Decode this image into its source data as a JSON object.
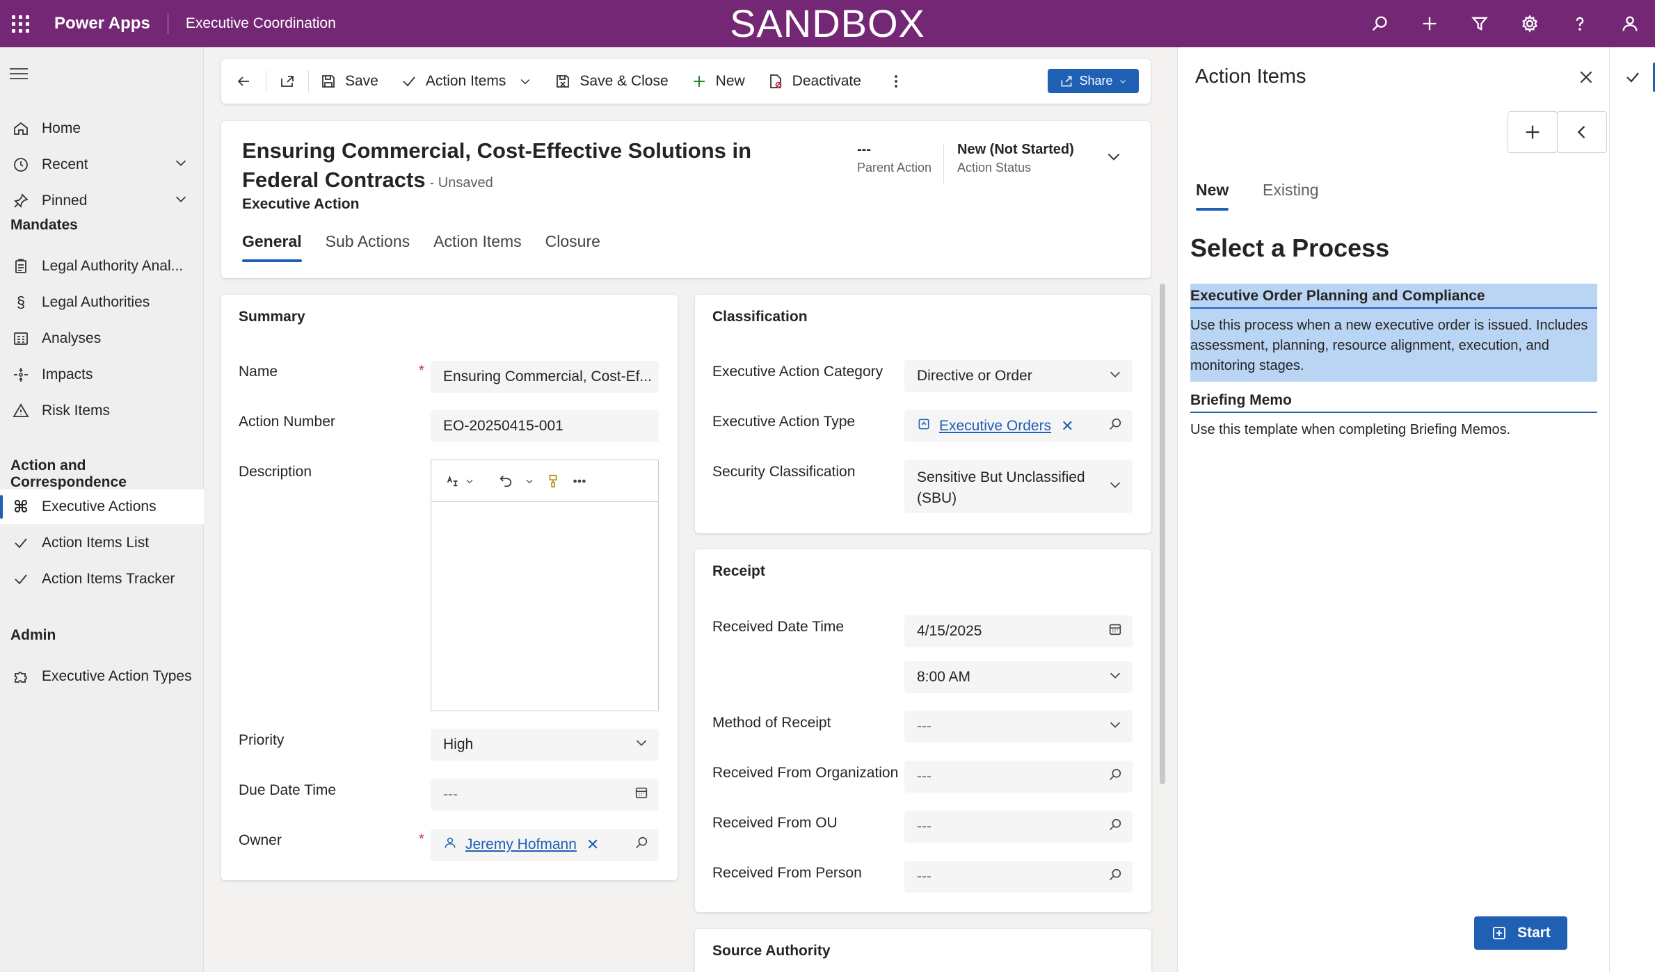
{
  "topbar": {
    "app_name": "Power Apps",
    "environment": "Executive Coordination",
    "banner": "SANDBOX"
  },
  "nav": {
    "home": "Home",
    "recent": "Recent",
    "pinned": "Pinned",
    "group_mandates": "Mandates",
    "legal_authority_analysis": "Legal Authority Anal...",
    "legal_authorities": "Legal Authorities",
    "analyses": "Analyses",
    "impacts": "Impacts",
    "risk_items": "Risk Items",
    "group_action": "Action and Correspondence",
    "executive_actions": "Executive Actions",
    "action_items_list": "Action Items List",
    "action_items_tracker": "Action Items Tracker",
    "group_admin": "Admin",
    "executive_action_types": "Executive Action Types"
  },
  "commands": {
    "save": "Save",
    "action_items": "Action Items",
    "save_close": "Save & Close",
    "new": "New",
    "deactivate": "Deactivate",
    "share": "Share"
  },
  "record": {
    "title": "Ensuring Commercial, Cost-Effective Solutions in Federal Contracts",
    "unsaved": "- Unsaved",
    "entity": "Executive Action",
    "parent_action_value": "---",
    "parent_action_label": "Parent Action",
    "status_value": "New (Not Started)",
    "status_label": "Action Status",
    "tabs": [
      "General",
      "Sub Actions",
      "Action Items",
      "Closure"
    ]
  },
  "summary": {
    "title": "Summary",
    "name_label": "Name",
    "name_value": "Ensuring Commercial, Cost-Ef...",
    "action_number_label": "Action Number",
    "action_number_value": "EO-20250415-001",
    "description_label": "Description",
    "priority_label": "Priority",
    "priority_value": "High",
    "due_label": "Due Date Time",
    "due_value": "---",
    "owner_label": "Owner",
    "owner_value": "Jeremy Hofmann"
  },
  "classification": {
    "title": "Classification",
    "category_label": "Executive Action Category",
    "category_value": "Directive or Order",
    "type_label": "Executive Action Type",
    "type_value": "Executive Orders",
    "security_label": "Security Classification",
    "security_value_line1": "Sensitive But Unclassified",
    "security_value_line2": "(SBU)"
  },
  "receipt": {
    "title": "Receipt",
    "received_label": "Received Date Time",
    "date_value": "4/15/2025",
    "time_value": "8:00 AM",
    "method_label": "Method of Receipt",
    "method_value": "---",
    "org_label": "Received From Organization",
    "org_value": "---",
    "ou_label": "Received From OU",
    "ou_value": "---",
    "person_label": "Received From Person",
    "person_value": "---"
  },
  "source_authority": {
    "title": "Source Authority"
  },
  "panel": {
    "title": "Action Items",
    "tab_new": "New",
    "tab_existing": "Existing",
    "heading": "Select a Process",
    "processes": [
      {
        "name": "Executive Order Planning and Compliance",
        "description": "Use this process when a new executive order is issued. Includes assessment, planning, resource alignment, execution, and monitoring stages."
      },
      {
        "name": "Briefing Memo",
        "description": "Use this template when completing Briefing Memos."
      }
    ],
    "start": "Start"
  },
  "colors": {
    "topbar": "#742774",
    "accent": "#1f5fb4",
    "selected_process": "#bad4f3",
    "required": "#c4314b"
  }
}
